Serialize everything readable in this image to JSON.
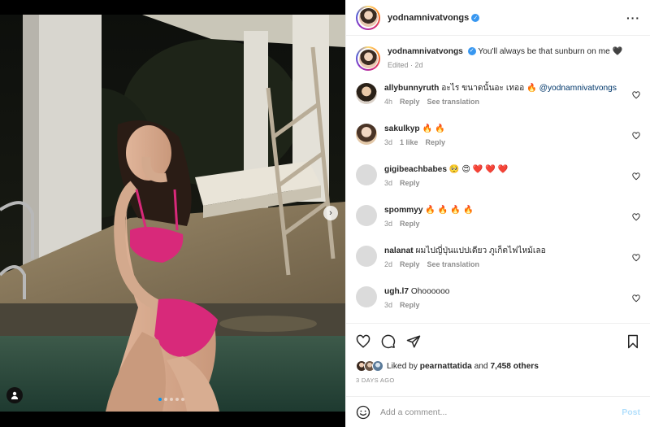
{
  "header": {
    "username": "yodnamnivatvongs",
    "more_icon": "more-horizontal-icon"
  },
  "caption": {
    "username": "yodnamnivatvongs",
    "text": "You'll always be that sunburn on me 🖤",
    "edited": "Edited",
    "time": "2d"
  },
  "comments": [
    {
      "username": "allybunnyruth",
      "text_before": "อะไร ขนาดนั้นอะ เทออ 🔥 ",
      "mention": "@yodnamnivatvongs",
      "time": "4h",
      "reply": "Reply",
      "translate": "See translation",
      "likes": ""
    },
    {
      "username": "sakulkyp",
      "text_before": "🔥 🔥",
      "mention": "",
      "time": "3d",
      "likes": "1 like",
      "reply": "Reply",
      "translate": ""
    },
    {
      "username": "gigibeachbabes",
      "text_before": "🥺 😍 ❤️ ❤️ ❤️",
      "mention": "",
      "time": "3d",
      "reply": "Reply",
      "translate": "",
      "likes": ""
    },
    {
      "username": "spommyy",
      "text_before": "🔥 🔥 🔥 🔥",
      "mention": "",
      "time": "3d",
      "reply": "Reply",
      "translate": "",
      "likes": ""
    },
    {
      "username": "nalanat",
      "text_before": "ผมไปญี่ปุ่นแปปเดียว ภูเก็ตไฟไหม้เลอ",
      "mention": "",
      "time": "2d",
      "reply": "Reply",
      "translate": "See translation",
      "likes": ""
    },
    {
      "username": "ugh.l7",
      "text_before": "Ohoooooo",
      "mention": "",
      "time": "3d",
      "reply": "Reply",
      "translate": "",
      "likes": ""
    }
  ],
  "likes": {
    "prefix": "Liked by ",
    "user": "pearnattatida",
    "middle": " and ",
    "others": "7,458 others"
  },
  "date": "3 DAYS AGO",
  "add_comment": {
    "placeholder": "Add a comment...",
    "post_label": "Post"
  },
  "colors": {
    "accent": "#0095f6",
    "verified": "#3897f0",
    "post_disabled": "#b2dffc",
    "muted": "#8e8e8e"
  }
}
